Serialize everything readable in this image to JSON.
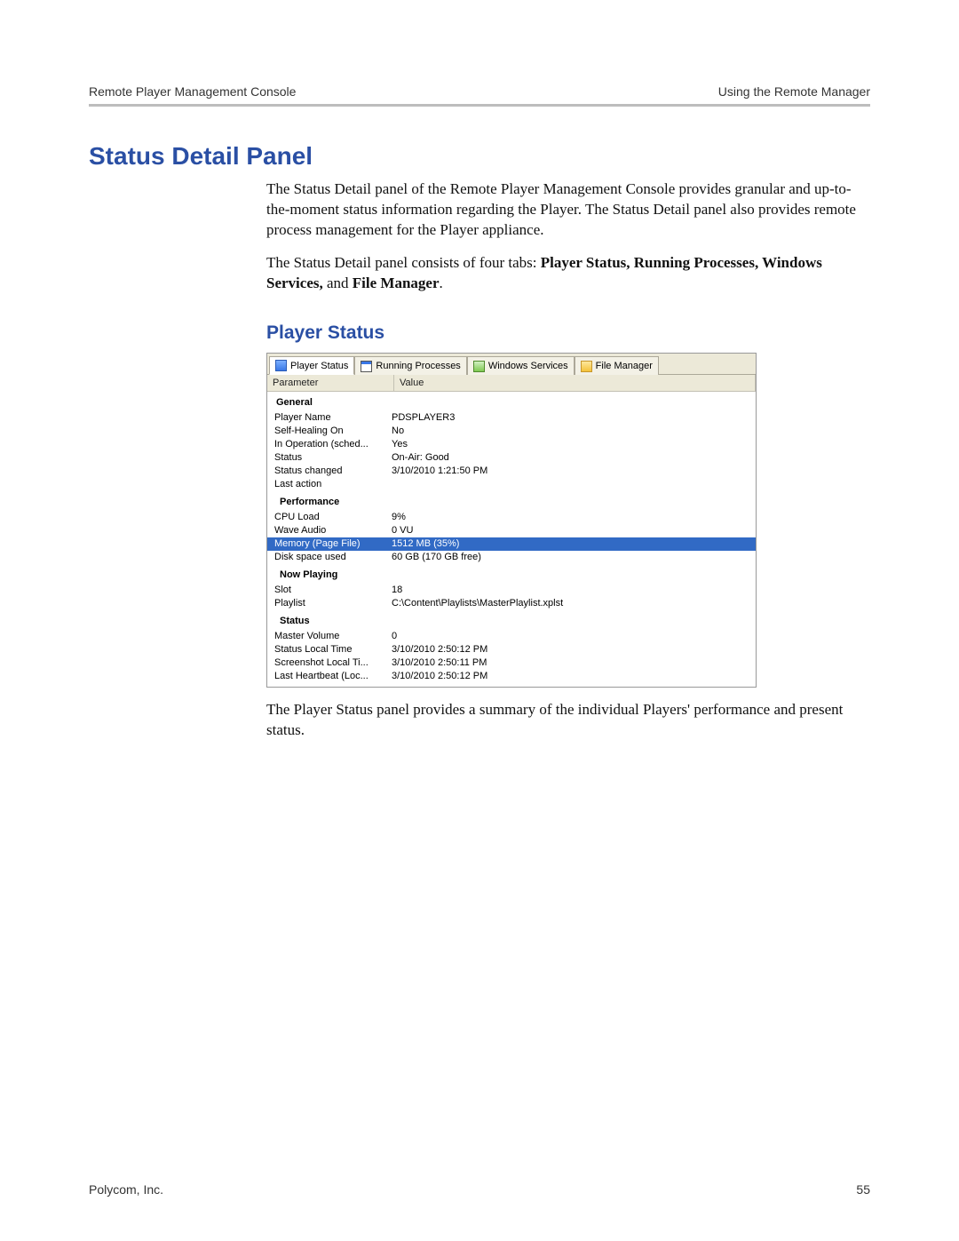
{
  "header": {
    "left": "Remote Player Management Console",
    "right": "Using the Remote Manager"
  },
  "section_title": "Status Detail Panel",
  "para1_pre": "The Status Detail panel of the Remote Player Management Console provides granular and up-to-the-moment status information regarding the Player. The Status Detail panel also provides remote process management for the Player appliance.",
  "para2": {
    "pre": "The Status Detail panel consists of four tabs: ",
    "b1": "Player Status, Running Processes, Windows Services, ",
    "mid": "and ",
    "b2": "File Manager",
    "post": "."
  },
  "subheading": "Player Status",
  "tabs": {
    "t0": "Player Status",
    "t1": "Running Processes",
    "t2": "Windows Services",
    "t3": "File Manager"
  },
  "columns": {
    "c0": "Parameter",
    "c1": "Value"
  },
  "groups": {
    "general": "General",
    "performance": "Performance",
    "now_playing": "Now Playing",
    "status": "Status"
  },
  "rows": {
    "player_name": {
      "p": "Player Name",
      "v": "PDSPLAYER3"
    },
    "self_healing": {
      "p": "Self-Healing On",
      "v": "No"
    },
    "in_operation": {
      "p": "In Operation (sched...",
      "v": "Yes"
    },
    "status": {
      "p": "Status",
      "v": "On-Air: Good"
    },
    "status_changed": {
      "p": "Status changed",
      "v": "3/10/2010 1:21:50 PM"
    },
    "last_action": {
      "p": "Last action",
      "v": ""
    },
    "cpu_load": {
      "p": "CPU Load",
      "v": "9%"
    },
    "wave_audio": {
      "p": "Wave Audio",
      "v": "0 VU"
    },
    "memory": {
      "p": "Memory (Page File)",
      "v": "1512 MB (35%)"
    },
    "disk": {
      "p": "Disk space used",
      "v": "60 GB (170 GB free)"
    },
    "slot": {
      "p": "Slot",
      "v": "18"
    },
    "playlist": {
      "p": "Playlist",
      "v": "C:\\Content\\Playlists\\MasterPlaylist.xplst"
    },
    "master_volume": {
      "p": "Master Volume",
      "v": "0"
    },
    "status_local_time": {
      "p": "Status Local Time",
      "v": "3/10/2010 2:50:12 PM"
    },
    "screenshot_local": {
      "p": "Screenshot Local Ti...",
      "v": "3/10/2010 2:50:11 PM"
    },
    "last_heartbeat": {
      "p": "Last Heartbeat (Loc...",
      "v": "3/10/2010 2:50:12 PM"
    }
  },
  "para3": "The Player Status panel provides a summary of the individual Players' performance and present status.",
  "footer": {
    "left": "Polycom, Inc.",
    "right": "55"
  }
}
